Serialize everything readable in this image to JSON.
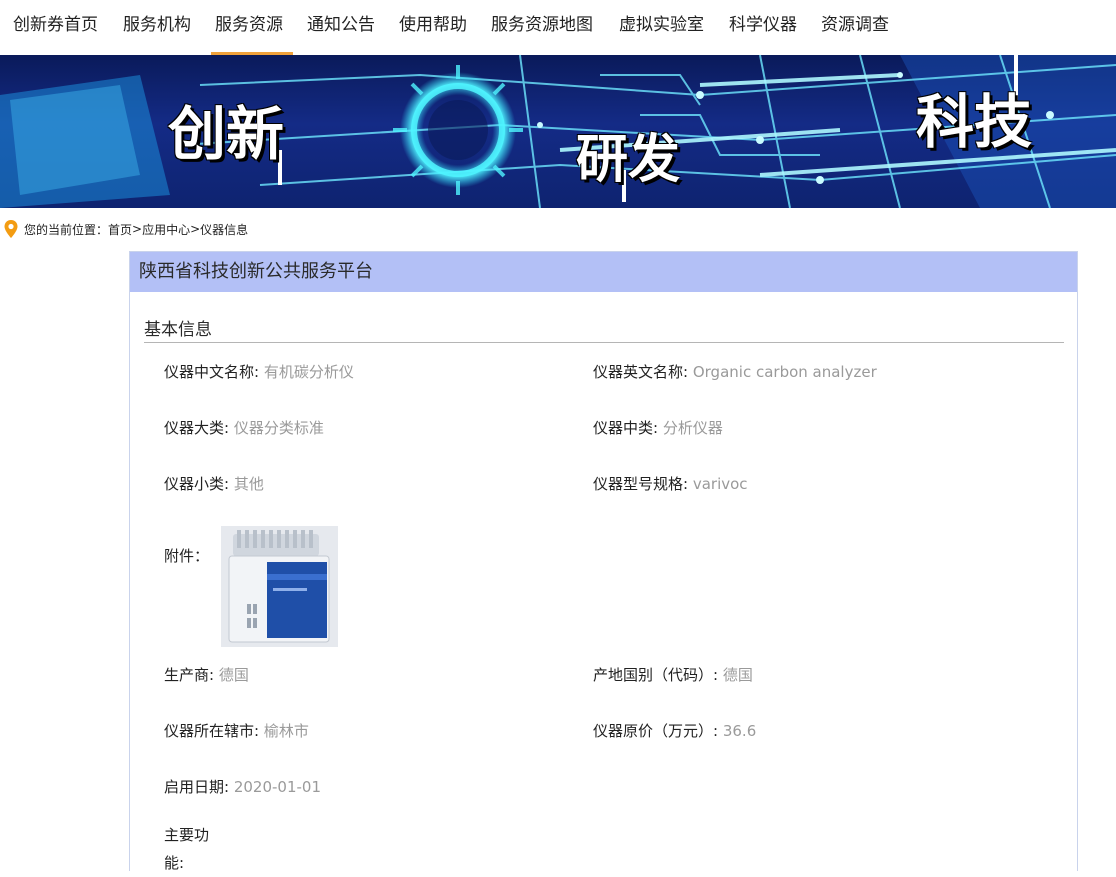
{
  "nav": {
    "items": [
      {
        "label": "创新券首页"
      },
      {
        "label": "服务机构"
      },
      {
        "label": "服务资源"
      },
      {
        "label": "通知公告"
      },
      {
        "label": "使用帮助"
      },
      {
        "label": "服务资源地图"
      },
      {
        "label": "虚拟实验室"
      },
      {
        "label": "科学仪器"
      },
      {
        "label": "资源调查"
      }
    ],
    "active_index": 2,
    "accent_color": "#f0a23b"
  },
  "banner": {
    "words": [
      "创新",
      "研发",
      "科技"
    ]
  },
  "breadcrumb": {
    "prefix": "您的当前位置：",
    "items": [
      "首页",
      "应用中心",
      "仪器信息"
    ],
    "separator": ">"
  },
  "panel": {
    "title": "陕西省科技创新公共服务平台",
    "header_color": "#b3c0f6",
    "section_title": "基本信息",
    "fields": {
      "name_cn": {
        "label": "仪器中文名称:",
        "value": "有机碳分析仪"
      },
      "name_en": {
        "label": "仪器英文名称:",
        "value": "Organic carbon analyzer"
      },
      "category_major": {
        "label": "仪器大类:",
        "value": "仪器分类标准"
      },
      "category_mid": {
        "label": "仪器中类:",
        "value": "分析仪器"
      },
      "category_minor": {
        "label": "仪器小类:",
        "value": "其他"
      },
      "model": {
        "label": "仪器型号规格:",
        "value": "varivoc"
      },
      "manufacturer": {
        "label": "生产商:",
        "value": "德国"
      },
      "origin_country": {
        "label": "产地国别（代码）:",
        "value": "德国"
      },
      "city": {
        "label": "仪器所在辖市:",
        "value": "榆林市"
      },
      "price": {
        "label": "仪器原价（万元）:",
        "value": "36.6"
      },
      "start_date": {
        "label": "启用日期:",
        "value": "2020-01-01"
      }
    },
    "attachment_label": "附件：",
    "function_label": "主要功能:"
  }
}
